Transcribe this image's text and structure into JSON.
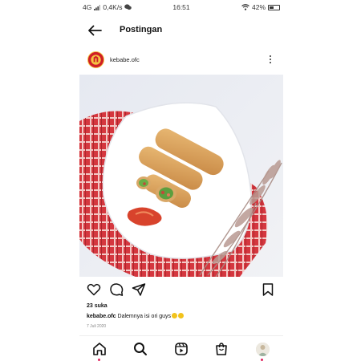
{
  "status_bar": {
    "network": "4G",
    "speed": "0,4K/s",
    "time": "16:51",
    "battery": "42%"
  },
  "header": {
    "title": "Postingan",
    "back_icon": "arrow-left-icon"
  },
  "post": {
    "username": "kebabe.ofc",
    "image_subject": "kebab rolls on white plate",
    "likes": "23 suka",
    "caption_user": "kebabe.ofc",
    "caption_text": "Dalemnya isi ori guys",
    "date": "7 Juli 2020"
  },
  "actions": [
    "heart-icon",
    "comment-icon",
    "share-icon",
    "bookmark-icon"
  ],
  "bottom_nav": [
    "home-icon",
    "search-icon",
    "reels-icon",
    "shop-icon",
    "profile-avatar"
  ],
  "colors": {
    "accent_red": "#d01f26",
    "notification_dot": "#e0245e",
    "emoji_yellow": "#f2c31c"
  }
}
